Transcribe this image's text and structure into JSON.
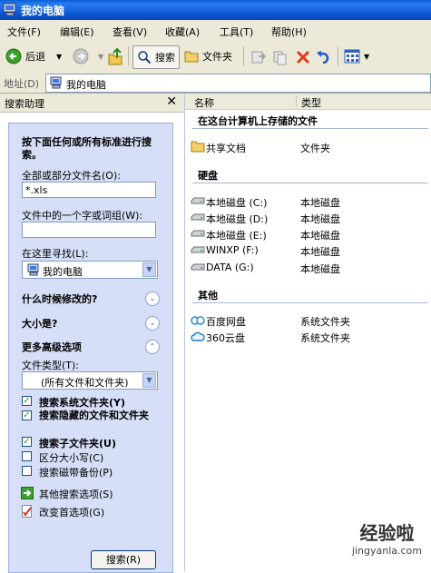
{
  "window": {
    "title": "我的电脑"
  },
  "menu": [
    "文件(F)",
    "编辑(E)",
    "查看(V)",
    "收藏(A)",
    "工具(T)",
    "帮助(H)"
  ],
  "toolbar": {
    "back_label": "后退",
    "search_label": "搜索",
    "folders_label": "文件夹"
  },
  "address": {
    "label": "地址(D)",
    "value": "我的电脑"
  },
  "search_panel": {
    "title": "搜索助理",
    "heading": "按下面任何或所有标准进行搜索。",
    "filename_label": "全部或部分文件名(O):",
    "filename_value": "*.xls",
    "word_label": "文件中的一个字或词组(W):",
    "word_value": "",
    "lookin_label": "在这里寻找(L):",
    "lookin_value": "我的电脑",
    "when_label": "什么时候修改的?",
    "size_label": "大小是?",
    "advanced_label": "更多高级选项",
    "filetype_label": "文件类型(T):",
    "filetype_value": "(所有文件和文件夹)",
    "options": [
      {
        "label": "搜索系统文件夹(Y)",
        "checked": true
      },
      {
        "label": "搜索隐藏的文件和文件夹",
        "checked": true
      },
      {
        "label": "搜索子文件夹(U)",
        "checked": true
      },
      {
        "label": "区分大小写(C)",
        "checked": false
      },
      {
        "label": "搜索磁带备份(P)",
        "checked": false
      }
    ],
    "other_options_label": "其他搜索选项(S)",
    "change_prefs_label": "改变首选项(G)",
    "search_button": "搜索(R)"
  },
  "list": {
    "col_name": "名称",
    "col_type": "类型",
    "groups": [
      {
        "title": "在这台计算机上存储的文件",
        "items": [
          {
            "name": "共享文档",
            "type": "文件夹",
            "icon": "folder-icon"
          }
        ]
      },
      {
        "title": "硬盘",
        "items": [
          {
            "name": "本地磁盘 (C:)",
            "type": "本地磁盘",
            "icon": "drive-icon"
          },
          {
            "name": "本地磁盘 (D:)",
            "type": "本地磁盘",
            "icon": "drive-icon"
          },
          {
            "name": "本地磁盘 (E:)",
            "type": "本地磁盘",
            "icon": "drive-icon"
          },
          {
            "name": "WINXP (F:)",
            "type": "本地磁盘",
            "icon": "drive-icon"
          },
          {
            "name": "DATA (G:)",
            "type": "本地磁盘",
            "icon": "drive-icon"
          }
        ]
      },
      {
        "title": "其他",
        "items": [
          {
            "name": "百度网盘",
            "type": "系统文件夹",
            "icon": "baidu-cloud-icon"
          },
          {
            "name": "360云盘",
            "type": "系统文件夹",
            "icon": "cloud-icon"
          }
        ]
      }
    ]
  },
  "watermark": {
    "line1": "经验啦",
    "line2": "jingyanla.com"
  }
}
